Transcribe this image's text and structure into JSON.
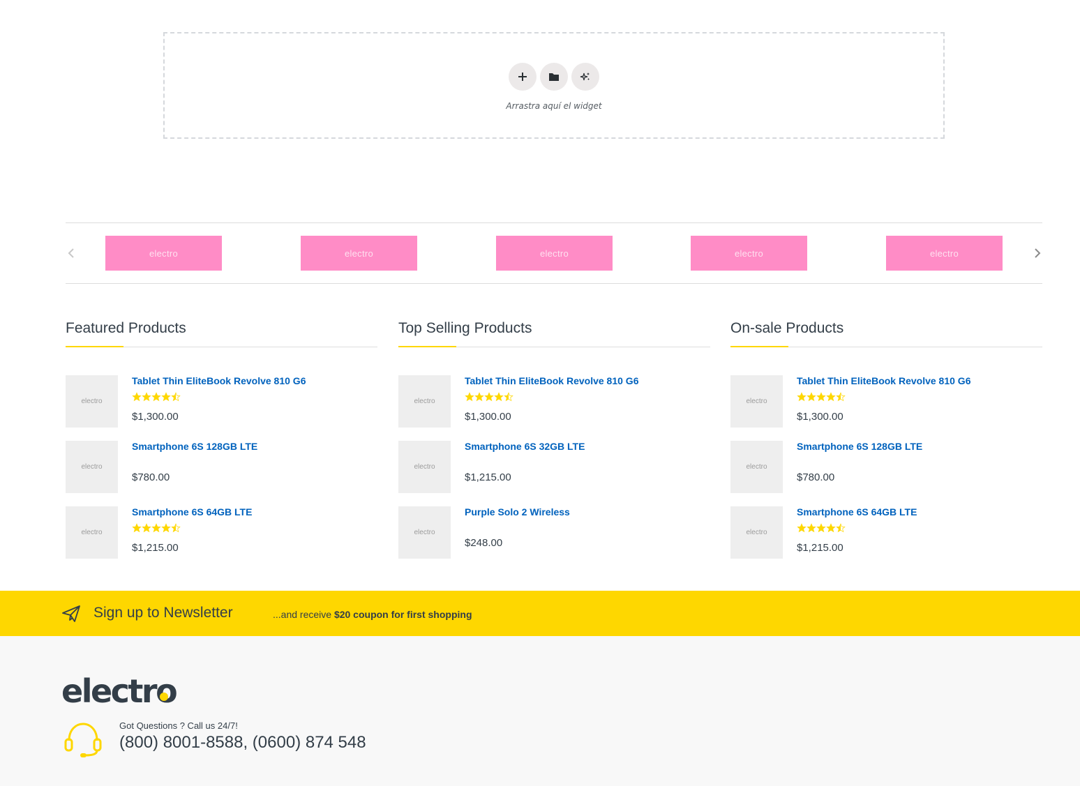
{
  "dropzone": {
    "add_icon": "plus-icon",
    "template_icon": "folder-icon",
    "ai_icon": "sparkle-icon",
    "hint": "Arrastra aquí el widget"
  },
  "brands": {
    "prev_icon": "chevron-left-icon",
    "next_icon": "chevron-right-icon",
    "items": [
      "electro",
      "electro",
      "electro",
      "electro",
      "electro"
    ]
  },
  "columns": [
    {
      "title": "Featured Products",
      "products": [
        {
          "thumb": "electro",
          "name": "Tablet Thin EliteBook Revolve 810 G6",
          "rating": 4.5,
          "price": "$1,300.00"
        },
        {
          "thumb": "electro",
          "name": "Smartphone 6S 128GB LTE",
          "rating": 0,
          "price": "$780.00"
        },
        {
          "thumb": "electro",
          "name": "Smartphone 6S 64GB LTE",
          "rating": 4.5,
          "price": "$1,215.00"
        }
      ]
    },
    {
      "title": "Top Selling Products",
      "products": [
        {
          "thumb": "electro",
          "name": "Tablet Thin EliteBook Revolve 810 G6",
          "rating": 4.5,
          "price": "$1,300.00"
        },
        {
          "thumb": "electro",
          "name": "Smartphone 6S 32GB LTE",
          "rating": 0,
          "price": "$1,215.00"
        },
        {
          "thumb": "electro",
          "name": "Purple Solo 2 Wireless",
          "rating": 0,
          "price": "$248.00"
        }
      ]
    },
    {
      "title": "On-sale Products",
      "products": [
        {
          "thumb": "electro",
          "name": "Tablet Thin EliteBook Revolve 810 G6",
          "rating": 4.5,
          "price": "$1,300.00"
        },
        {
          "thumb": "electro",
          "name": "Smartphone 6S 128GB LTE",
          "rating": 0,
          "price": "$780.00"
        },
        {
          "thumb": "electro",
          "name": "Smartphone 6S 64GB LTE",
          "rating": 4.5,
          "price": "$1,215.00"
        }
      ]
    }
  ],
  "newsletter": {
    "icon": "paper-plane-icon",
    "title": "Sign up to Newsletter",
    "sub_prefix": "...and receive ",
    "sub_bold": "$20 coupon for first shopping"
  },
  "footer": {
    "logo": "electro",
    "support_icon": "headset-icon",
    "support_label": "Got Questions ? Call us 24/7!",
    "phone": "(800) 8001-8588, (0600) 874 548"
  },
  "colors": {
    "accent": "#fed700",
    "link": "#0062bd",
    "text": "#333e48",
    "brand_placeholder": "#ff86c3",
    "star": "#fed700"
  }
}
